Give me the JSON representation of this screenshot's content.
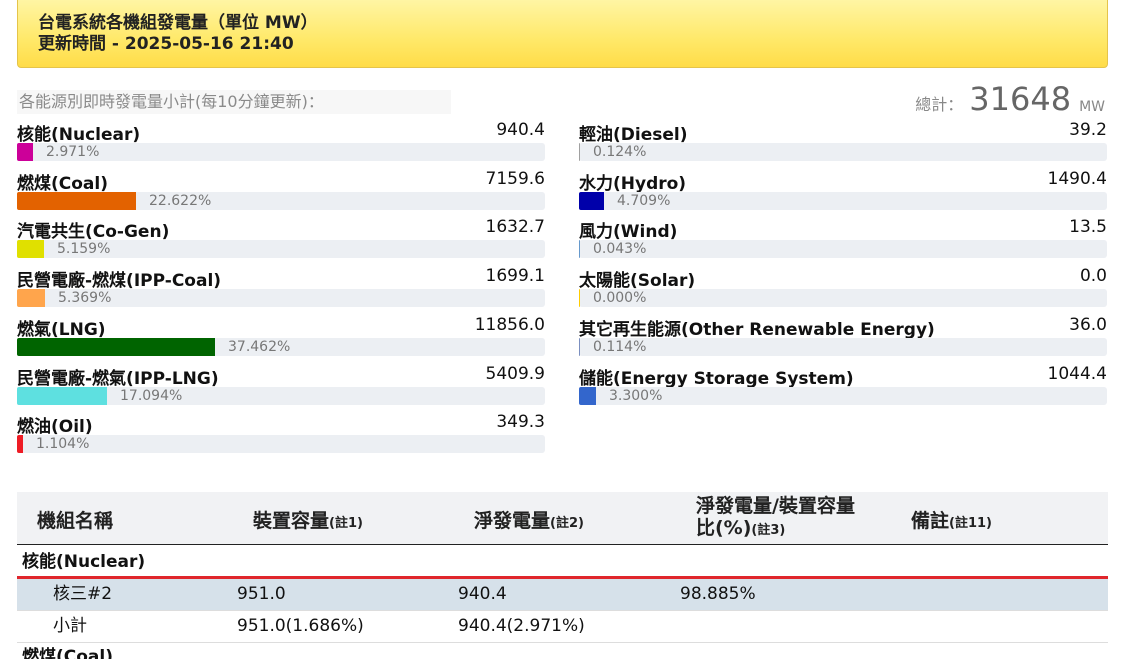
{
  "header": {
    "title": "台電系統各機組發電量（單位 MW）",
    "update_time": "更新時間 - 2025-05-16 21:40"
  },
  "summary": {
    "caption": "各能源別即時發電量小計(每10分鐘更新)：",
    "total_label": "總計：",
    "total_value": "31648",
    "total_unit": "MW"
  },
  "sources_left": [
    {
      "name": "核能(Nuclear)",
      "value": "940.4",
      "pct": "2.971%",
      "fraction": 0.02971,
      "color": "#cc0099"
    },
    {
      "name": "燃煤(Coal)",
      "value": "7159.6",
      "pct": "22.622%",
      "fraction": 0.22622,
      "color": "#e36200"
    },
    {
      "name": "汽電共生(Co-Gen)",
      "value": "1632.7",
      "pct": "5.159%",
      "fraction": 0.05159,
      "color": "#e0e000"
    },
    {
      "name": "民營電廠-燃煤(IPP-Coal)",
      "value": "1699.1",
      "pct": "5.369%",
      "fraction": 0.05369,
      "color": "#ffa54c"
    },
    {
      "name": "燃氣(LNG)",
      "value": "11856.0",
      "pct": "37.462%",
      "fraction": 0.37462,
      "color": "#006400"
    },
    {
      "name": "民營電廠-燃氣(IPP-LNG)",
      "value": "5409.9",
      "pct": "17.094%",
      "fraction": 0.17094,
      "color": "#5ee0e0"
    },
    {
      "name": "燃油(Oil)",
      "value": "349.3",
      "pct": "1.104%",
      "fraction": 0.01104,
      "color": "#ee1c25"
    }
  ],
  "sources_right": [
    {
      "name": "輕油(Diesel)",
      "value": "39.2",
      "pct": "0.124%",
      "fraction": 0.00124,
      "color": "#a0a0a0"
    },
    {
      "name": "水力(Hydro)",
      "value": "1490.4",
      "pct": "4.709%",
      "fraction": 0.04709,
      "color": "#0000aa"
    },
    {
      "name": "風力(Wind)",
      "value": "13.5",
      "pct": "0.043%",
      "fraction": 0.00043,
      "color": "#6699cc"
    },
    {
      "name": "太陽能(Solar)",
      "value": "0.0",
      "pct": "0.000%",
      "fraction": 0.0,
      "color": "#ffcc00"
    },
    {
      "name": "其它再生能源(Other Renewable Energy)",
      "value": "36.0",
      "pct": "0.114%",
      "fraction": 0.00114,
      "color": "#7b8fc0"
    },
    {
      "name": "儲能(Energy Storage System)",
      "value": "1044.4",
      "pct": "3.300%",
      "fraction": 0.033,
      "color": "#3366cc"
    }
  ],
  "table": {
    "headers": {
      "unit_name": "機組名稱",
      "capacity": "裝置容量",
      "capacity_note": "(註1)",
      "net_gen": "淨發電量",
      "net_gen_note": "(註2)",
      "ratio_line1": "淨發電量/裝置容量",
      "ratio_line2": "比(%)",
      "ratio_note": "(註3)",
      "remark": "備註",
      "remark_note": "(註11)"
    },
    "group_nuclear": "核能(Nuclear)",
    "rows": [
      {
        "name": "核三#2",
        "capacity": "951.0",
        "net": "940.4",
        "ratio": "98.885%"
      },
      {
        "name": "小計",
        "capacity": "951.0(1.686%)",
        "net": "940.4(2.971%)",
        "ratio": ""
      }
    ],
    "group_coal": "燃煤(Coal)"
  }
}
